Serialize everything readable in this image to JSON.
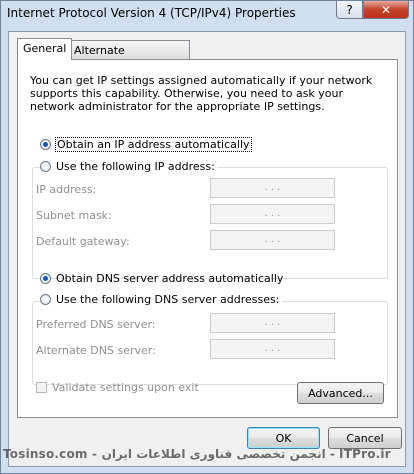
{
  "window": {
    "title": "Internet Protocol Version 4 (TCP/IPv4) Properties",
    "help_label": "?",
    "close_label": "✕"
  },
  "tabs": [
    {
      "label": "General"
    },
    {
      "label": "Alternate Configuration"
    }
  ],
  "description": "You can get IP settings assigned automatically if your network supports this capability. Otherwise, you need to ask your network administrator for the appropriate IP settings.",
  "ip": {
    "auto_label": "Obtain an IP address automatically",
    "manual_label": "Use the following IP address:",
    "fields": [
      {
        "label": "IP address:",
        "value": ". . ."
      },
      {
        "label": "Subnet mask:",
        "value": ". . ."
      },
      {
        "label": "Default gateway:",
        "value": ". . ."
      }
    ]
  },
  "dns": {
    "auto_label": "Obtain DNS server address automatically",
    "manual_label": "Use the following DNS server addresses:",
    "fields": [
      {
        "label": "Preferred DNS server:",
        "value": ". . ."
      },
      {
        "label": "Alternate DNS server:",
        "value": ". . ."
      }
    ]
  },
  "validate_label": "Validate settings upon exit",
  "buttons": {
    "advanced": "Advanced...",
    "ok": "OK",
    "cancel": "Cancel"
  },
  "watermark": "Tosinso.com - انجمن تخصصی فناوری اطلاعات ایران - ITPro.ir"
}
